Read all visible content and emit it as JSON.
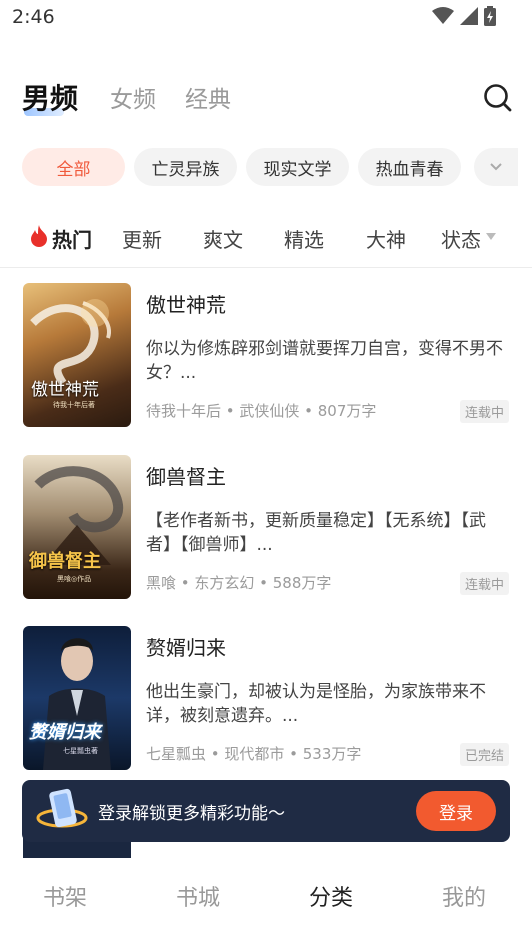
{
  "status": {
    "time": "2:46",
    "icons": [
      "wifi-icon",
      "signal-icon",
      "battery-icon"
    ]
  },
  "topnav": {
    "tabs": [
      {
        "label": "男频"
      },
      {
        "label": "女频"
      },
      {
        "label": "经典"
      }
    ],
    "search_icon": "search-icon"
  },
  "chips": [
    {
      "label": "全部"
    },
    {
      "label": "亡灵异族"
    },
    {
      "label": "现实文学"
    },
    {
      "label": "热血青春"
    }
  ],
  "chips_more_icon": "chevron-down-icon",
  "filters": [
    {
      "label": "热门"
    },
    {
      "label": "更新"
    },
    {
      "label": "爽文"
    },
    {
      "label": "精选"
    },
    {
      "label": "大神"
    },
    {
      "label": "状态"
    }
  ],
  "books": [
    {
      "title": "傲世神荒",
      "desc": "你以为修炼辟邪剑谱就要挥刀自宫，变得不男不女？...",
      "meta": "待我十年后 • 武侠仙侠 • 807万字",
      "status": "连载中",
      "cover_text": "傲世神荒",
      "cover_sub": "待我十年后著"
    },
    {
      "title": "御兽督主",
      "desc": "【老作者新书，更新质量稳定】【无系统】【武者】【御兽师】...",
      "meta": "黑喰 • 东方玄幻 • 588万字",
      "status": "连载中",
      "cover_text": "御兽督主",
      "cover_sub": "黑喰◎作品"
    },
    {
      "title": "赘婿归来",
      "desc": "他出生豪门，却被认为是怪胎，为家族带来不详，被刻意遗弃。...",
      "meta": "七星瓢虫 • 现代都市 • 533万字",
      "status": "已完结",
      "cover_text": "赘婿归来",
      "cover_sub": "七星瓢虫著"
    }
  ],
  "banner": {
    "text": "登录解锁更多精彩功能～",
    "button": "登录"
  },
  "bottomnav": [
    {
      "label": "书架"
    },
    {
      "label": "书城"
    },
    {
      "label": "分类"
    },
    {
      "label": "我的"
    }
  ],
  "colors": {
    "accent": "#f25a2f",
    "chip_active_bg": "#ffebe6",
    "chip_active_text": "#f05a3c",
    "banner_bg": "#1f2b44",
    "hot": "#e8302a"
  }
}
